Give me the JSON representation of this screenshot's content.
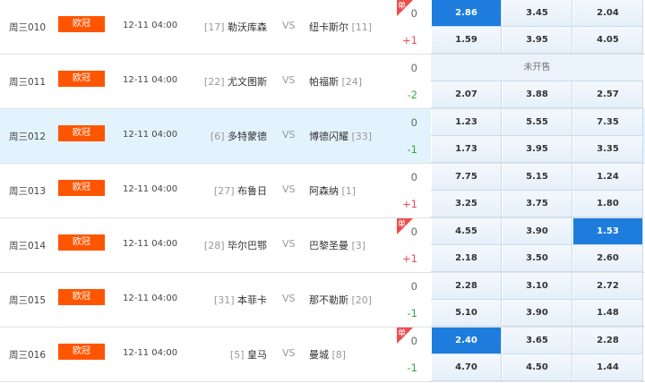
{
  "matches": [
    {
      "code": "周三010",
      "league": "欧冠",
      "time": "12-11 04:00",
      "home_rank": "[17]",
      "home": "勒沃库森",
      "vs": "VS",
      "away": "纽卡斯尔",
      "away_rank": "[11]",
      "single": "单",
      "hc0": "0",
      "hc1": "+1",
      "odds0": [
        "2.86",
        "3.45",
        "2.04"
      ],
      "odds1": [
        "1.59",
        "3.95",
        "4.05"
      ],
      "sel0": 0,
      "sel1": -1
    },
    {
      "code": "周三011",
      "league": "欧冠",
      "time": "12-11 04:00",
      "home_rank": "[22]",
      "home": "尤文图斯",
      "vs": "VS",
      "away": "帕福斯",
      "away_rank": "[24]",
      "hc0": "0",
      "hc1": "-2",
      "not_on_sale": "未开售",
      "odds1": [
        "2.07",
        "3.88",
        "2.57"
      ],
      "sel0": -1,
      "sel1": -1
    },
    {
      "code": "周三012",
      "league": "欧冠",
      "time": "12-11 04:00",
      "home_rank": "[6]",
      "home": "多特蒙德",
      "vs": "VS",
      "away": "博德闪耀",
      "away_rank": "[33]",
      "hc0": "0",
      "hc1": "-1",
      "odds0": [
        "1.23",
        "5.55",
        "7.35"
      ],
      "odds1": [
        "1.73",
        "3.95",
        "3.35"
      ],
      "sel0": -1,
      "sel1": -1,
      "highlight": true
    },
    {
      "code": "周三013",
      "league": "欧冠",
      "time": "12-11 04:00",
      "home_rank": "[27]",
      "home": "布鲁日",
      "vs": "VS",
      "away": "阿森纳",
      "away_rank": "[1]",
      "hc0": "0",
      "hc1": "+1",
      "odds0": [
        "7.75",
        "5.15",
        "1.24"
      ],
      "odds1": [
        "3.25",
        "3.75",
        "1.80"
      ],
      "sel0": -1,
      "sel1": -1
    },
    {
      "code": "周三014",
      "league": "欧冠",
      "time": "12-11 04:00",
      "home_rank": "[28]",
      "home": "毕尔巴鄂",
      "vs": "VS",
      "away": "巴黎圣曼",
      "away_rank": "[3]",
      "single": "单",
      "hc0": "0",
      "hc1": "+1",
      "odds0": [
        "4.55",
        "3.90",
        "1.53"
      ],
      "odds1": [
        "2.18",
        "3.50",
        "2.60"
      ],
      "sel0": 2,
      "sel1": -1
    },
    {
      "code": "周三015",
      "league": "欧冠",
      "time": "12-11 04:00",
      "home_rank": "[31]",
      "home": "本菲卡",
      "vs": "VS",
      "away": "那不勒斯",
      "away_rank": "[20]",
      "hc0": "0",
      "hc1": "-1",
      "odds0": [
        "2.28",
        "3.10",
        "2.72"
      ],
      "odds1": [
        "5.10",
        "3.90",
        "1.48"
      ],
      "sel0": -1,
      "sel1": -1
    },
    {
      "code": "周三016",
      "league": "欧冠",
      "time": "12-11 04:00",
      "home_rank": "[5]",
      "home": "皇马",
      "vs": "VS",
      "away": "曼城",
      "away_rank": "[8]",
      "single": "单",
      "hc0": "0",
      "hc1": "-1",
      "odds0": [
        "2.40",
        "3.65",
        "2.28"
      ],
      "odds1": [
        "4.70",
        "4.50",
        "1.44"
      ],
      "sel0": 0,
      "sel1": -1
    }
  ],
  "colors": {
    "accent": "#1e7ddc",
    "league": "#ff5500",
    "plus": "#f04b5a",
    "minus": "#3aa34a"
  }
}
